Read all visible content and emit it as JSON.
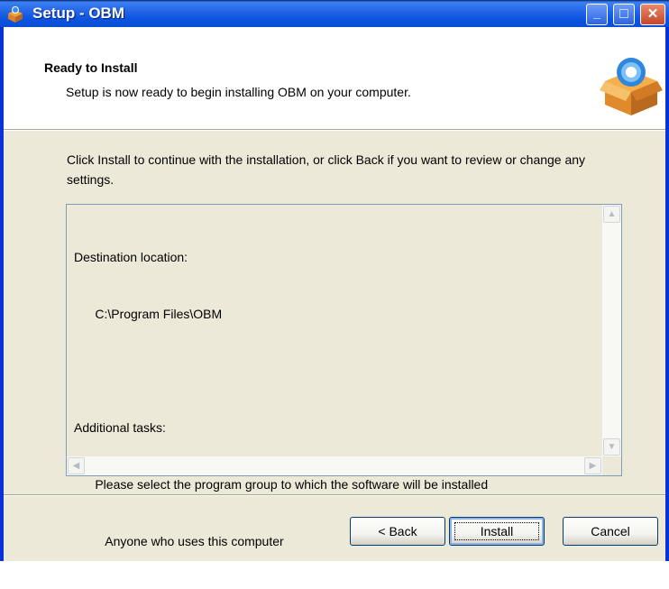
{
  "window": {
    "title": "Setup - OBM",
    "minimize_glyph": "_",
    "maximize_glyph": "□",
    "close_glyph": "✕"
  },
  "header": {
    "title": "Ready to Install",
    "subtitle": "Setup is now ready to begin installing OBM on your computer."
  },
  "body": {
    "intro": "Click Install to continue with the installation, or click Back if you want to review or change any settings.",
    "memo": [
      "Destination location:",
      "      C:\\Program Files\\OBM",
      "",
      "Additional tasks:",
      "      Please select the program group to which the software will be installed",
      "         Anyone who uses this computer"
    ]
  },
  "buttons": {
    "back": "< Back",
    "install": "Install",
    "cancel": "Cancel"
  },
  "colors": {
    "titlebar": "#0B55E0",
    "dialog_bg": "#ECE9D8",
    "close_button": "#C8452A"
  }
}
